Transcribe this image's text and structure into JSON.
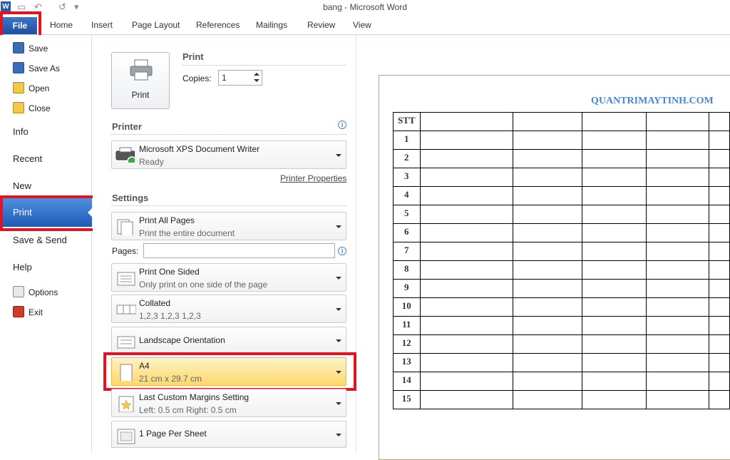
{
  "titlebar": {
    "title": "bang  -  Microsoft Word",
    "logo": "W",
    "save_icon": "▭",
    "undo_icon": "↶",
    "redo_icon": "↺",
    "customize_icon": "▾"
  },
  "ribbon": {
    "file": "File",
    "tabs": [
      "Home",
      "Insert",
      "Page Layout",
      "References",
      "Mailings",
      "Review",
      "View"
    ]
  },
  "backstage": {
    "commands": [
      {
        "label": "Save",
        "icon": "save-icon"
      },
      {
        "label": "Save As",
        "icon": "save-as-icon"
      },
      {
        "label": "Open",
        "icon": "open-folder-icon"
      },
      {
        "label": "Close",
        "icon": "close-folder-icon"
      }
    ],
    "categories": [
      "Info",
      "Recent",
      "New",
      "Print",
      "Save & Send",
      "Help"
    ],
    "selected": "Print",
    "footer": [
      {
        "label": "Options",
        "icon": "options-icon"
      },
      {
        "label": "Exit",
        "icon": "exit-icon"
      }
    ]
  },
  "print": {
    "heading": "Print",
    "button_label": "Print",
    "copies_label": "Copies:",
    "copies_value": "1",
    "printer_heading": "Printer",
    "info_icon": "i",
    "printer_name": "Microsoft XPS Document Writer",
    "printer_status": "Ready",
    "printer_properties": "Printer Properties",
    "settings_heading": "Settings",
    "pages_label": "Pages:",
    "pages_value": "",
    "settings": [
      {
        "line1": "Print All Pages",
        "line2": "Print the entire document"
      },
      {
        "line1": "Print One Sided",
        "line2": "Only print on one side of the page"
      },
      {
        "line1": "Collated",
        "line2": "1,2,3    1,2,3    1,2,3"
      },
      {
        "line1": "Landscape Orientation",
        "line2": ""
      },
      {
        "line1": "A4",
        "line2": "21 cm x 29.7 cm"
      },
      {
        "line1": "Last Custom Margins Setting",
        "line2": "Left:  0.5 cm    Right:  0.5 cm"
      },
      {
        "line1": "1 Page Per Sheet",
        "line2": ""
      }
    ]
  },
  "document": {
    "header": "QUANTRIMAYTINH.COM",
    "table_header": "STT",
    "rows": [
      "1",
      "2",
      "3",
      "4",
      "5",
      "6",
      "7",
      "8",
      "9",
      "10",
      "11",
      "12",
      "13",
      "14",
      "15"
    ]
  },
  "colors": {
    "accent_blue": "#2a5aa8",
    "highlight_red": "#e2141f",
    "selected_yellow": "#fde48a",
    "header_blue": "#4a86c9"
  }
}
